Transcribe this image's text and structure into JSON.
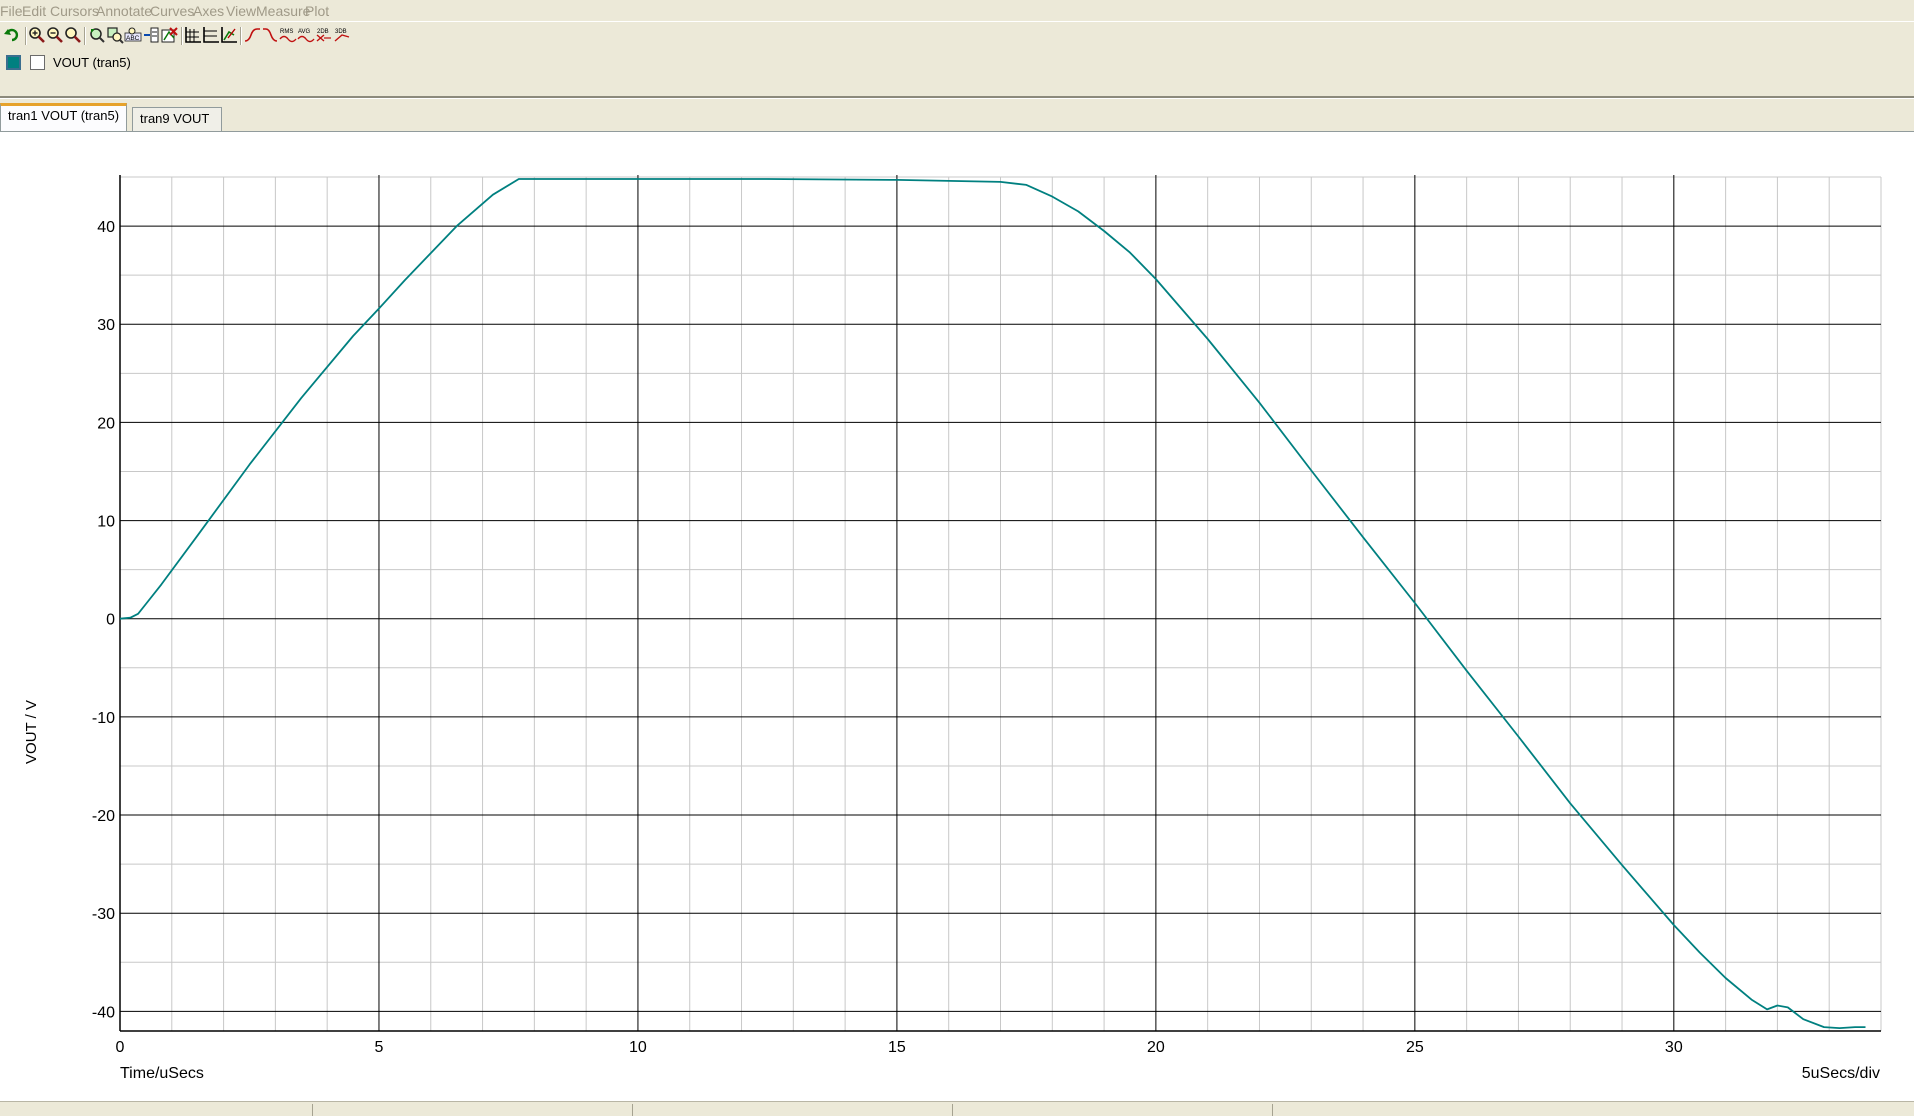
{
  "menu": [
    "File",
    "Edit",
    "Cursors",
    "Annotate",
    "Curves",
    "Axes",
    "View",
    "Measure",
    "Plot"
  ],
  "toolbar": {
    "icons": [
      "undo-icon",
      "zoom-in-icon",
      "zoom-out-icon",
      "zoom-fit-icon",
      "zoom-area-icon",
      "zoom-box-icon",
      "zoom-abc-icon",
      "add-curve-icon",
      "delete-curve-icon",
      "grid-icon",
      "grid-lines-icon",
      "axis-icon",
      "rise-edge-icon",
      "fall-edge-icon",
      "rms-icon",
      "avg-icon",
      "db2-icon",
      "db3-icon"
    ],
    "text_icons": {
      "rms": "RMS",
      "avg": "AVG",
      "db2": "2DB",
      "db3": "3DB",
      "abc": "ABC"
    }
  },
  "curve_legend": {
    "label": "VOUT (tran5)",
    "color": "#008080"
  },
  "tabs": [
    {
      "label": "tran1 VOUT (tran5)",
      "active": true
    },
    {
      "label": "tran9 VOUT",
      "active": false
    }
  ],
  "chart_data": {
    "type": "line",
    "xlabel": "Time/uSecs",
    "ylabel": "VOUT / V",
    "division_label": "5uSecs/div",
    "xlim": [
      0,
      33.7
    ],
    "ylim": [
      -42,
      45
    ],
    "x_ticks": [
      0,
      5,
      10,
      15,
      20,
      25,
      30
    ],
    "y_ticks": [
      -40,
      -30,
      -20,
      -10,
      0,
      10,
      20,
      30,
      40
    ],
    "x_minor_step": 1,
    "y_minor_step": 5,
    "grid": true,
    "series": [
      {
        "color": "#008080",
        "x": [
          0,
          0.2,
          0.35,
          0.5,
          0.8,
          1.5,
          2.5,
          3.5,
          4.5,
          5,
          5.5,
          6.5,
          7.2,
          7.7,
          10,
          12.5,
          15,
          16,
          17,
          17.5,
          18,
          18.5,
          19,
          19.5,
          20,
          21,
          22,
          23,
          24,
          25,
          26,
          27,
          28,
          29,
          30,
          30.5,
          31,
          31.5,
          31.8,
          32.0,
          32.2,
          32.5,
          32.9,
          33.2,
          33.5,
          33.7
        ],
        "y": [
          0,
          0.1,
          0.5,
          1.5,
          3.5,
          8.5,
          15.7,
          22.5,
          28.8,
          31.6,
          34.5,
          40.0,
          43.2,
          44.8,
          44.8,
          44.8,
          44.7,
          44.6,
          44.5,
          44.2,
          43.0,
          41.5,
          39.5,
          37.3,
          34.6,
          28.5,
          22.0,
          15.1,
          8.3,
          1.6,
          -5.3,
          -12.0,
          -18.8,
          -25.1,
          -31.2,
          -34.0,
          -36.6,
          -38.8,
          -39.8,
          -39.4,
          -39.6,
          -40.8,
          -41.6,
          -41.7,
          -41.6,
          -41.6
        ]
      }
    ]
  }
}
